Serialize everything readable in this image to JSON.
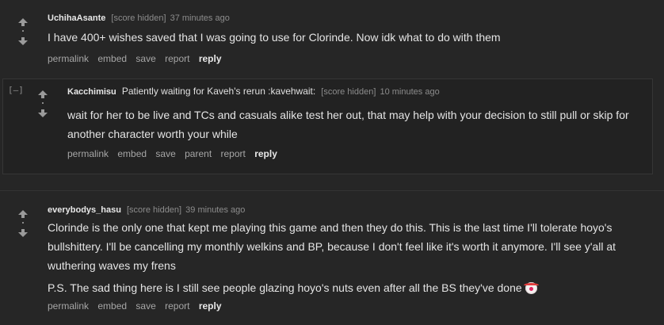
{
  "comments": [
    {
      "author": "UchihaAsante",
      "score": "[score hidden]",
      "time": "37 minutes ago",
      "body": [
        "I have 400+ wishes saved that I was going to use for Clorinde. Now idk what to do with them"
      ],
      "buttons": [
        "permalink",
        "embed",
        "save",
        "report"
      ],
      "reply": "reply"
    },
    {
      "collapse": "[–]",
      "author": "Kacchimisu",
      "flair": "Patiently waiting for Kaveh's rerun :kavehwait:",
      "score": "[score hidden]",
      "time": "10 minutes ago",
      "body": [
        "wait for her to be live and TCs and casuals alike test her out, that may help with your decision to still pull or skip for another character worth your while"
      ],
      "buttons": [
        "permalink",
        "embed",
        "save",
        "parent",
        "report"
      ],
      "reply": "reply"
    },
    {
      "author": "everybodys_hasu",
      "score": "[score hidden]",
      "time": "39 minutes ago",
      "body": [
        "Clorinde is the only one that kept me playing this game and then they do this. This is the last time I'll tolerate hoyo's bullshittery. I'll be cancelling my monthly welkins and BP, because I don't feel like it's worth it anymore. I'll see y'all at wuthering waves my frens",
        "P.S. The sad thing here is I still see people glazing hoyo's nuts even after all the BS they've done"
      ],
      "emoji": "clown-face",
      "buttons": [
        "permalink",
        "embed",
        "save",
        "report"
      ],
      "reply": "reply"
    }
  ]
}
